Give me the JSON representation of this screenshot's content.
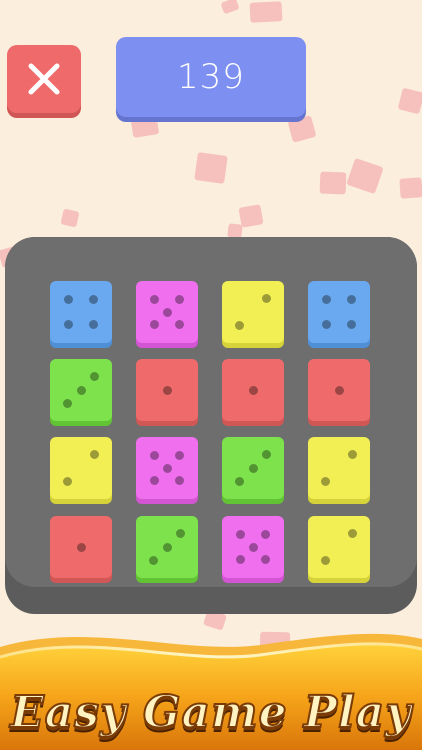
{
  "score": "139",
  "close_icon_name": "close-icon",
  "banner_text": "Easy Game Play",
  "colors": {
    "background": "#fbeedd",
    "board": "#6e6e6e",
    "close_button": "#ef6b6b",
    "score_box": "#7d8ff0",
    "blue": "#6aa9ef",
    "magenta": "#ef6fef",
    "yellow": "#f2ef55",
    "green": "#7ee24d",
    "red": "#ef6b6b",
    "banner_text": "#fff3c2"
  },
  "board": [
    [
      {
        "color": "blue",
        "value": 4
      },
      {
        "color": "magenta",
        "value": 5
      },
      {
        "color": "yellow",
        "value": 2
      },
      {
        "color": "blue",
        "value": 4
      }
    ],
    [
      {
        "color": "green",
        "value": 3
      },
      {
        "color": "red",
        "value": 1
      },
      {
        "color": "red",
        "value": 1
      },
      {
        "color": "red",
        "value": 1
      }
    ],
    [
      {
        "color": "yellow",
        "value": 2
      },
      {
        "color": "magenta",
        "value": 5
      },
      {
        "color": "green",
        "value": 3
      },
      {
        "color": "yellow",
        "value": 2
      }
    ],
    [
      {
        "color": "red",
        "value": 1
      },
      {
        "color": "green",
        "value": 3
      },
      {
        "color": "magenta",
        "value": 5
      },
      {
        "color": "yellow",
        "value": 2
      }
    ]
  ]
}
